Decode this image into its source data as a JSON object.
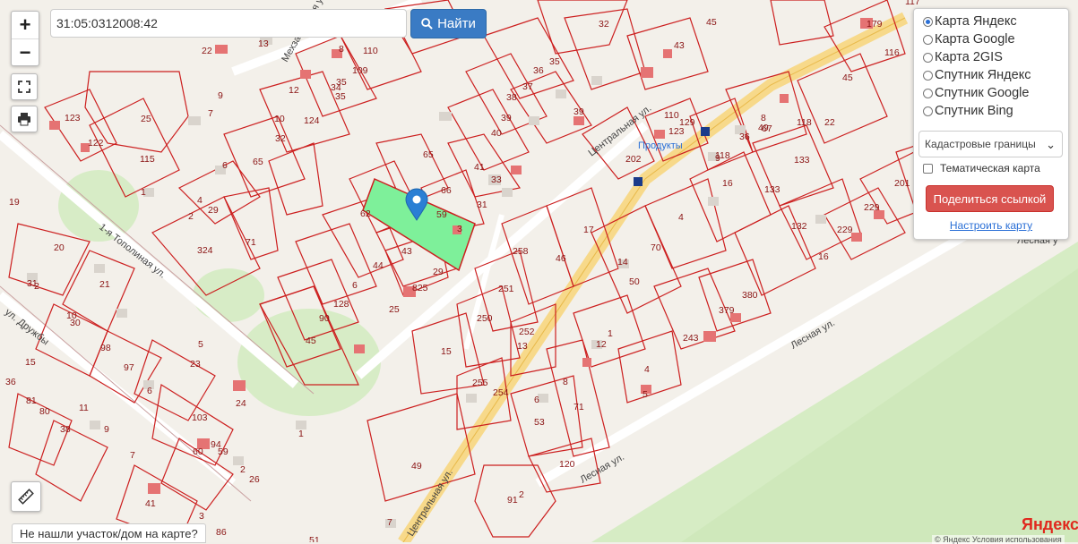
{
  "search": {
    "value": "31:05:0312008:42",
    "button_label": "Найти"
  },
  "zoom": {
    "in_label": "+",
    "out_label": "−"
  },
  "map_types": [
    {
      "label": "Карта Яндекс",
      "checked": true
    },
    {
      "label": "Карта Google",
      "checked": false
    },
    {
      "label": "Карта 2GIS",
      "checked": false
    },
    {
      "label": "Спутник Яндекс",
      "checked": false
    },
    {
      "label": "Спутник Google",
      "checked": false
    },
    {
      "label": "Спутник Bing",
      "checked": false
    }
  ],
  "layer_select": {
    "selected": "Кадастровые границы"
  },
  "thematic_map": {
    "label": "Тематическая карта",
    "checked": false
  },
  "share_button": "Поделиться ссылкой",
  "setup_link": "Настроить карту",
  "not_found": "Не нашли участок/дом на карте?",
  "yandex_logo": "Яндекс",
  "copyright": "© Яндекс   Условия использования",
  "streets": [
    "Центральная ул.",
    "Центральная ул.",
    "1-я Тополиная ул.",
    "ул. Дружбы",
    "Лесная ул.",
    "Лесная ул.",
    "Лесная у",
    "Мехзаводская ул."
  ],
  "poi": "Продукты",
  "parcel_numbers": [
    "22",
    "13",
    "8",
    "110",
    "32",
    "45",
    "117",
    "35",
    "109",
    "36",
    "35",
    "43",
    "116",
    "179",
    "123",
    "25",
    "9",
    "7",
    "12",
    "35",
    "34",
    "124",
    "38",
    "37",
    "39",
    "39",
    "45",
    "122",
    "10",
    "32",
    "40",
    "65",
    "115",
    "65",
    "6",
    "66",
    "41",
    "33",
    "16",
    "9",
    "19",
    "1",
    "29",
    "4",
    "62",
    "59",
    "31",
    "3",
    "20",
    "2",
    "324",
    "71",
    "43",
    "29",
    "17",
    "44",
    "6",
    "825",
    "128",
    "25",
    "90",
    "45",
    "21",
    "31",
    "2",
    "30",
    "10",
    "98",
    "97",
    "5",
    "6",
    "23",
    "15",
    "36",
    "81",
    "80",
    "38",
    "11",
    "9",
    "7",
    "103",
    "24",
    "60",
    "94",
    "59",
    "26",
    "2",
    "41",
    "86",
    "3",
    "7",
    "49",
    "1",
    "51",
    "2",
    "91",
    "120",
    "53",
    "6",
    "71",
    "8",
    "12",
    "1",
    "4",
    "243",
    "379",
    "380",
    "50",
    "14",
    "70",
    "46",
    "258",
    "251",
    "250",
    "252",
    "15",
    "255",
    "254",
    "13",
    "5",
    "4",
    "49",
    "8",
    "118",
    "22",
    "133",
    "133",
    "132",
    "16",
    "229",
    "229",
    "201",
    "202",
    "123",
    "129",
    "110",
    "67",
    "36",
    "118",
    "20",
    "12"
  ]
}
